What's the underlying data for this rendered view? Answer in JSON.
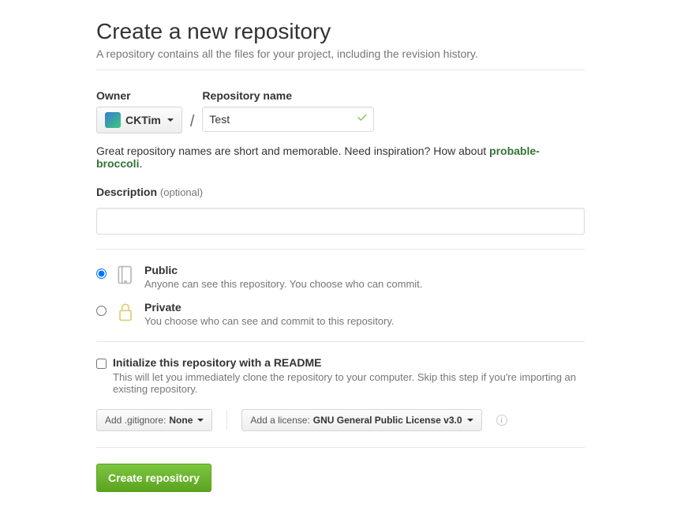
{
  "header": {
    "title": "Create a new repository",
    "subhead": "A repository contains all the files for your project, including the revision history."
  },
  "owner": {
    "label": "Owner",
    "username": "CKTim"
  },
  "repo": {
    "label": "Repository name",
    "value": "Test"
  },
  "hint": {
    "text_before": "Great repository names are short and memorable. Need inspiration? How about ",
    "suggestion": "probable-broccoli",
    "text_after": "."
  },
  "description": {
    "label": "Description",
    "optional": "(optional)",
    "value": ""
  },
  "visibility": {
    "public": {
      "title": "Public",
      "desc": "Anyone can see this repository. You choose who can commit.",
      "selected": true
    },
    "private": {
      "title": "Private",
      "desc": "You choose who can see and commit to this repository.",
      "selected": false
    }
  },
  "initialize": {
    "label": "Initialize this repository with a README",
    "desc": "This will let you immediately clone the repository to your computer. Skip this step if you're importing an existing repository.",
    "checked": false
  },
  "gitignore": {
    "prefix": "Add .gitignore: ",
    "value": "None"
  },
  "license": {
    "prefix": "Add a license: ",
    "value": "GNU General Public License v3.0"
  },
  "submit": {
    "label": "Create repository"
  }
}
